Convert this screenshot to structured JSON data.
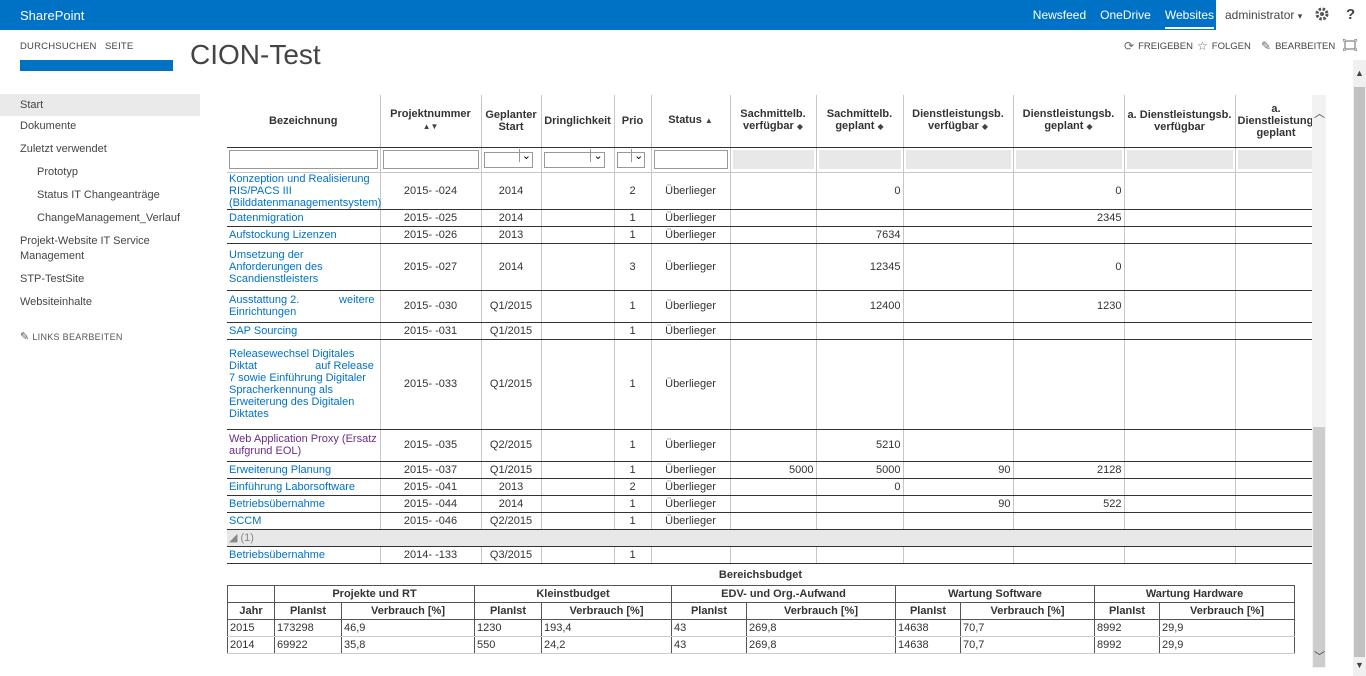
{
  "suitebar": {
    "brand": "SharePoint",
    "links": [
      "Newsfeed",
      "OneDrive",
      "Websites"
    ],
    "user": "administrator",
    "user_chevron": "▾",
    "help": "?"
  },
  "ribbon": {
    "tabs": [
      "DURCHSUCHEN",
      "SEITE"
    ],
    "share": "FREIGEBEN",
    "follow": "FOLGEN",
    "edit": "BEARBEITEN"
  },
  "site": {
    "title": "CION-Test"
  },
  "nav": {
    "items": [
      "Start",
      "Dokumente",
      "Zuletzt verwendet",
      "Prototyp",
      "Status IT Changeanträge",
      "ChangeManagement_Verlauf",
      "Projekt-Website IT Service Management",
      "STP-TestSite",
      "Websiteinhalte"
    ],
    "edit_links": "LINKS BEARBEITEN"
  },
  "list": {
    "headers": [
      "Bezeichnung",
      "Projektnummer",
      "Geplanter Start",
      "Dringlichkeit",
      "Prio",
      "Status",
      "Sachmittelb. verfügbar",
      "Sachmittelb. geplant",
      "Dienstleistungsb. verfügbar",
      "Dienstleistungsb. geplant",
      "a. Dienstleistungsb. verfügbar",
      "a. Dienstleistungsb. geplant"
    ],
    "rows": [
      {
        "name": "Konzeption und Realisierung RIS/PACS III (Bilddatenmanagementsystem)",
        "nr": "2015-      -024",
        "start": "2014",
        "prio": "2",
        "status": "Überlieger",
        "sv": "",
        "sg": "0",
        "dv": "",
        "dg": "0"
      },
      {
        "name": "Datenmigration",
        "nr": "2015-      -025",
        "start": "2014",
        "prio": "1",
        "status": "Überlieger",
        "sv": "",
        "sg": "",
        "dv": "",
        "dg": "2345"
      },
      {
        "name": "Aufstockung Lizenzen",
        "nr": "2015-      -026",
        "start": "2013",
        "prio": "1",
        "status": "Überlieger",
        "sv": "",
        "sg": "7634",
        "dv": "",
        "dg": ""
      },
      {
        "name": "Umsetzung der Anforderungen des Scandienstleisters",
        "nr": "2015-      -027",
        "start": "2014",
        "prio": "3",
        "status": "Überlieger",
        "sv": "",
        "sg": "12345",
        "dv": "",
        "dg": "0"
      },
      {
        "name": "Ausstattung 2.             weitere Einrichtungen",
        "nr": "2015-      -030",
        "start": "Q1/2015",
        "prio": "1",
        "status": "Überlieger",
        "sv": "",
        "sg": "12400",
        "dv": "",
        "dg": "1230"
      },
      {
        "name": "SAP Sourcing",
        "nr": "2015-      -031",
        "start": "Q1/2015",
        "prio": "1",
        "status": "Überlieger",
        "sv": "",
        "sg": "",
        "dv": "",
        "dg": ""
      },
      {
        "name": "Releasewechsel Digitales Diktat                   auf Release 7 sowie Einführung Digitaler Spracherkennung als Erweiterung des Digitalen Diktates",
        "nr": "2015-      -033",
        "start": "Q1/2015",
        "prio": "1",
        "status": "Überlieger",
        "sv": "",
        "sg": "",
        "dv": "",
        "dg": ""
      },
      {
        "name": "Web Application Proxy (Ersatz                          aufgrund EOL)",
        "nr": "2015-      -035",
        "start": "Q2/2015",
        "prio": "1",
        "status": "Überlieger",
        "sv": "",
        "sg": "5210",
        "dv": "",
        "dg": ""
      },
      {
        "name": "Erweiterung Planung",
        "nr": "2015-      -037",
        "start": "Q1/2015",
        "prio": "1",
        "status": "Überlieger",
        "sv": "5000",
        "sg": "5000",
        "dv": "90",
        "dg": "2128"
      },
      {
        "name": "Einführung Laborsoftware",
        "nr": "2015-      -041",
        "start": "2013",
        "prio": "2",
        "status": "Überlieger",
        "sv": "",
        "sg": "0",
        "dv": "",
        "dg": ""
      },
      {
        "name": "Betriebsübernahme",
        "nr": "2015-      -044",
        "start": "2014",
        "prio": "1",
        "status": "Überlieger",
        "sv": "",
        "sg": "",
        "dv": "90",
        "dg": "522"
      },
      {
        "name": "SCCM",
        "nr": "2015-      -046",
        "start": "Q2/2015",
        "prio": "1",
        "status": "Überlieger",
        "sv": "",
        "sg": "",
        "dv": "",
        "dg": ""
      }
    ],
    "group_label": "◢  (1)",
    "last_row": {
      "name": "Betriebsübernahme",
      "nr": "2014-      -133",
      "start": "Q3/2015",
      "prio": "1"
    }
  },
  "budget": {
    "caption": "Bereichsbudget",
    "groups": [
      "Projekte und RT",
      "Kleinstbudget",
      "EDV- und Org.-Aufwand",
      "Wartung Software",
      "Wartung Hardware"
    ],
    "year_label": "Jahr",
    "col_plan": "PlanIst",
    "col_use": "Verbrauch [%]",
    "rows": [
      {
        "year": "2015",
        "cells": [
          "173298",
          "46,9",
          "1230",
          "193,4",
          "43",
          "269,8",
          "14638",
          "70,7",
          "8992",
          "29,9"
        ]
      },
      {
        "year": "2014",
        "cells": [
          "69922",
          "35,8",
          "550",
          "24,2",
          "43",
          "269,8",
          "14638",
          "70,7",
          "8992",
          "29,9"
        ]
      }
    ]
  }
}
